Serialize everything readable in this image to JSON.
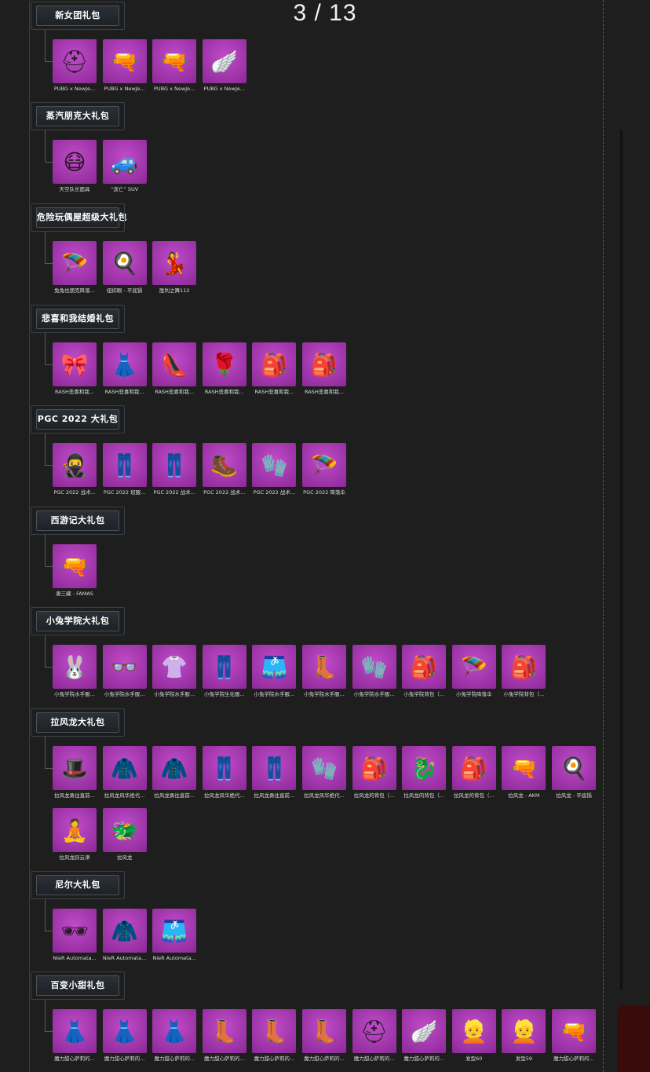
{
  "page_counter": "3 / 13",
  "sections": [
    {
      "title": "新女团礼包",
      "items": [
        {
          "label": "PUBG x NewJe...",
          "icon": "helmet-icon",
          "glyph": "⛑"
        },
        {
          "label": "PUBG x NewJe...",
          "icon": "rifle-icon",
          "glyph": "🔫"
        },
        {
          "label": "PUBG x NewJe...",
          "icon": "rifle-icon",
          "glyph": "🔫"
        },
        {
          "label": "PUBG x NewJe...",
          "icon": "glider-icon",
          "glyph": "🪽"
        }
      ]
    },
    {
      "title": "蒸汽朋克大礼包",
      "items": [
        {
          "label": "天空队长面具",
          "icon": "gas-mask-icon",
          "glyph": "😷"
        },
        {
          "label": "“逝亡” SUV",
          "icon": "car-icon",
          "glyph": "🚙"
        }
      ]
    },
    {
      "title": "危险玩偶屋超级大礼包",
      "items": [
        {
          "label": "兔兔也朋克降落...",
          "icon": "parachute-icon",
          "glyph": "🪂"
        },
        {
          "label": "纽扣眼 - 平底锅",
          "icon": "pan-icon",
          "glyph": "🍳"
        },
        {
          "label": "胜利之舞112",
          "icon": "dance-icon",
          "glyph": "💃"
        }
      ]
    },
    {
      "title": "悲喜和我结婚礼包",
      "items": [
        {
          "label": "RASH悲喜和我...",
          "icon": "headband-icon",
          "glyph": "🎀"
        },
        {
          "label": "RASH悲喜和我...",
          "icon": "dress-icon",
          "glyph": "👗"
        },
        {
          "label": "RASH悲喜和我...",
          "icon": "heels-icon",
          "glyph": "👠"
        },
        {
          "label": "RASH悲喜和我...",
          "icon": "backpack-icon",
          "glyph": "🌹"
        },
        {
          "label": "RASH悲喜和我...",
          "icon": "backpack-icon",
          "glyph": "🎒"
        },
        {
          "label": "RASH悲喜和我...",
          "icon": "backpack-icon",
          "glyph": "🎒"
        }
      ]
    },
    {
      "title": "PGC 2022 大礼包",
      "items": [
        {
          "label": "PGC 2022 战术...",
          "icon": "mask-icon",
          "glyph": "🥷"
        },
        {
          "label": "PGC 2022 班服...",
          "icon": "pants-icon",
          "glyph": "👖"
        },
        {
          "label": "PGC 2022 战术...",
          "icon": "pants-icon",
          "glyph": "👖"
        },
        {
          "label": "PGC 2022 战术...",
          "icon": "boots-icon",
          "glyph": "🥾"
        },
        {
          "label": "PGC 2022 战术...",
          "icon": "gloves-icon",
          "glyph": "🧤"
        },
        {
          "label": "PGC 2022 降落伞",
          "icon": "parachute-icon",
          "glyph": "🪂"
        }
      ]
    },
    {
      "title": "西游记大礼包",
      "items": [
        {
          "label": "唐三藏 - FAMAS",
          "icon": "rifle-icon",
          "glyph": "🔫"
        }
      ]
    },
    {
      "title": "小兔学院大礼包",
      "items": [
        {
          "label": "小兔学院水手服...",
          "icon": "bunny-hat-icon",
          "glyph": "🐰"
        },
        {
          "label": "小兔学院水手服...",
          "icon": "glasses-icon",
          "glyph": "👓"
        },
        {
          "label": "小兔学院水手服...",
          "icon": "shirt-icon",
          "glyph": "👚"
        },
        {
          "label": "小兔学院生化服...",
          "icon": "pants-icon",
          "glyph": "👖"
        },
        {
          "label": "小兔学院水手服...",
          "icon": "skirt-icon",
          "glyph": "🩳"
        },
        {
          "label": "小兔学院水手服...",
          "icon": "boots-icon",
          "glyph": "👢"
        },
        {
          "label": "小兔学院水手服...",
          "icon": "gloves-icon",
          "glyph": "🧤"
        },
        {
          "label": "小兔学院背包（...",
          "icon": "backpack-icon",
          "glyph": "🎒"
        },
        {
          "label": "小兔学院降落伞",
          "icon": "parachute-icon",
          "glyph": "🪂"
        },
        {
          "label": "小兔学院背包（...",
          "icon": "backpack-icon",
          "glyph": "🎒"
        }
      ]
    },
    {
      "title": "拉风龙大礼包",
      "items": [
        {
          "label": "拉风龙勇往直前...",
          "icon": "hat-icon",
          "glyph": "🎩"
        },
        {
          "label": "拉风龙风华绝代...",
          "icon": "jacket-icon",
          "glyph": "🧥"
        },
        {
          "label": "拉风龙勇往直前...",
          "icon": "jacket-icon",
          "glyph": "🧥"
        },
        {
          "label": "拉风龙风华绝代...",
          "icon": "pants-icon",
          "glyph": "👖"
        },
        {
          "label": "拉风龙勇往直前...",
          "icon": "pants-icon",
          "glyph": "👖"
        },
        {
          "label": "拉风龙风华绝代...",
          "icon": "gloves-icon",
          "glyph": "🧤"
        },
        {
          "label": "拉风龙的背包（...",
          "icon": "backpack-icon",
          "glyph": "🎒"
        },
        {
          "label": "拉风龙的背包（...",
          "icon": "backpack-icon",
          "glyph": "🐉"
        },
        {
          "label": "拉风龙的背包（...",
          "icon": "backpack-icon",
          "glyph": "🎒"
        },
        {
          "label": "拉风龙 - AKM",
          "icon": "rifle-icon",
          "glyph": "🔫"
        },
        {
          "label": "拉风龙 - 平底锅",
          "icon": "pan-icon",
          "glyph": "🍳"
        },
        {
          "label": "拉风龙跃云津",
          "icon": "emote-icon",
          "glyph": "🧘"
        },
        {
          "label": "拉风龙",
          "icon": "dragon-icon",
          "glyph": "🐲"
        }
      ]
    },
    {
      "title": "尼尔大礼包",
      "items": [
        {
          "label": "NieR Automata...",
          "icon": "blindfold-icon",
          "glyph": "🕶"
        },
        {
          "label": "NieR Automata...",
          "icon": "coat-icon",
          "glyph": "🧥"
        },
        {
          "label": "NieR Automata...",
          "icon": "shorts-icon",
          "glyph": "🩳"
        }
      ]
    },
    {
      "title": "百变小甜礼包",
      "items": [
        {
          "label": "魔力甜心萨莉的...",
          "icon": "outfit-icon",
          "glyph": "👗"
        },
        {
          "label": "魔力甜心萨莉的...",
          "icon": "outfit-icon",
          "glyph": "👗"
        },
        {
          "label": "魔力甜心萨莉的...",
          "icon": "outfit-icon",
          "glyph": "👗"
        },
        {
          "label": "魔力甜心萨莉的...",
          "icon": "boots-icon",
          "glyph": "👢"
        },
        {
          "label": "魔力甜心萨莉的...",
          "icon": "boots-icon",
          "glyph": "👢"
        },
        {
          "label": "魔力甜心萨莉的...",
          "icon": "boots-icon",
          "glyph": "👢"
        },
        {
          "label": "魔力甜心萨莉的...",
          "icon": "helmet-icon",
          "glyph": "⛑"
        },
        {
          "label": "魔力甜心萨莉的...",
          "icon": "pan-icon",
          "glyph": "🪽"
        },
        {
          "label": "发型60",
          "icon": "hair-icon",
          "glyph": "👱"
        },
        {
          "label": "发型59",
          "icon": "hair-icon",
          "glyph": "👱"
        },
        {
          "label": "魔力甜心萨莉的...",
          "icon": "rifle-icon",
          "glyph": "🔫"
        }
      ]
    }
  ]
}
